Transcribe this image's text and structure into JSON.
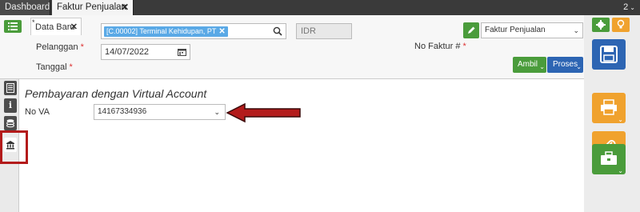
{
  "tabs": {
    "dashboard": "Dashboard",
    "faktur": "Faktur Penjualan",
    "close": "✕",
    "count": "2"
  },
  "form": {
    "subtab_label": "Data Baru",
    "subtab_star": "*",
    "pelanggan_label": "Pelanggan",
    "pelanggan_value": "[C.00002] Terminal Kehidupan, PT",
    "currency": "IDR",
    "tanggal_label": "Tanggal",
    "tanggal_value": "14/07/2022",
    "no_faktur_label": "No Faktur #",
    "faktur_type": "Faktur Penjualan",
    "required_mark": "*",
    "ambil_label": "Ambil",
    "proses_label": "Proses"
  },
  "main": {
    "title": "Pembayaran dengan Virtual Account",
    "va_label": "No VA",
    "va_value": "14167334936"
  },
  "colors": {
    "green": "#4a9c3b",
    "blue": "#2d65b3",
    "orange": "#f0a22e",
    "highlight": "#b31b1b"
  },
  "icons": {
    "list": "list-icon",
    "search": "search-icon",
    "calendar": "calendar-icon",
    "edit": "pencil-icon",
    "settings": "gear-icon",
    "bulb": "lightbulb-icon",
    "save": "save-icon",
    "print": "printer-icon",
    "attach": "paperclip-icon",
    "briefcase": "briefcase-icon",
    "rail": [
      "document-icon",
      "info-icon",
      "coins-icon",
      "bank-icon"
    ]
  }
}
